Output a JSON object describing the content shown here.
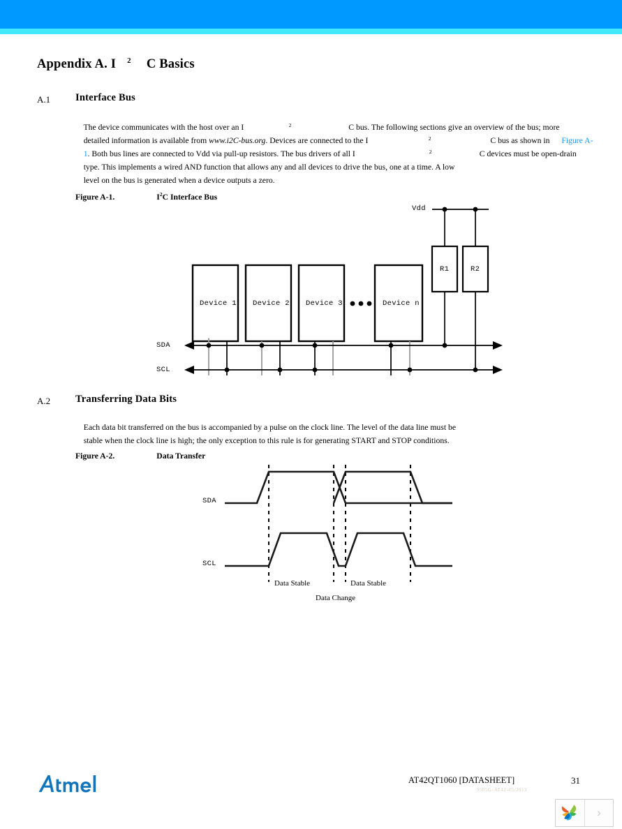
{
  "banner": {
    "primary_color": "#0099ff",
    "secondary_color": "#45e9ff"
  },
  "appendix": {
    "title_prefix": "Appendix A.  I",
    "title_superscript": "2",
    "title_suffix": "C Basics"
  },
  "sections": [
    {
      "number": "A.1",
      "heading": "Interface Bus"
    },
    {
      "number": "A.2",
      "heading": "Transferring Data Bits"
    }
  ],
  "interface_bus_paragraph": {
    "line1_a": "The device communicates with the host over an I",
    "line1_sup": "2",
    "line1_b": "C bus. The following sections give an overview of the bus; more",
    "line2_a": "detailed information is available from ",
    "line2_italic": "www.i2C-bus.org",
    "line2_b": ". Devices are connected to the I",
    "line2_sup": "2",
    "line2_c": "C bus as shown in ",
    "line2_link": "Figure A-",
    "line3_link": "1",
    "line3_a": ". Both bus lines are connected to Vdd via pull-up resistors. The bus drivers of all I",
    "line3_sup": "2",
    "line3_b": "C devices must be open-drain",
    "line4": "type. This implements a wired AND function that allows any and all devices to drive the bus, one at a time. A low",
    "line5": "level on the bus is generated when a device outputs a zero."
  },
  "data_bits_paragraph": {
    "line1": "Each data bit transferred on the bus is accompanied by a pulse on the clock line. The level of the data line must be",
    "line2": "stable when the clock line is high; the only exception to this rule is for generating START and STOP conditions."
  },
  "figure_a1": {
    "caption_number": "Figure A-1.",
    "caption_title_prefix": "I",
    "caption_superscript": "2",
    "caption_title_suffix": "C Interface Bus",
    "devices": [
      "Device 1",
      "Device 2",
      "Device 3",
      "Device n"
    ],
    "ellipsis": "• • •",
    "resistors": [
      "R1",
      "R2"
    ],
    "supply_label": "Vdd",
    "bus_lines": [
      "SDA",
      "SCL"
    ]
  },
  "figure_a2": {
    "caption_number": "Figure A-2.",
    "caption_title": "Data Transfer",
    "signals": [
      "SDA",
      "SCL"
    ],
    "annotations": [
      "Data Stable",
      "Data Stable",
      "Data Change"
    ]
  },
  "footer": {
    "logo_text": "Atmel",
    "logo_color": "#1175bb",
    "document": "AT42QT1060 [DATASHEET]",
    "doc_code": "9505G–AT42–05/2013",
    "page_number": "31"
  },
  "overlay": {
    "next_icon": "›"
  }
}
